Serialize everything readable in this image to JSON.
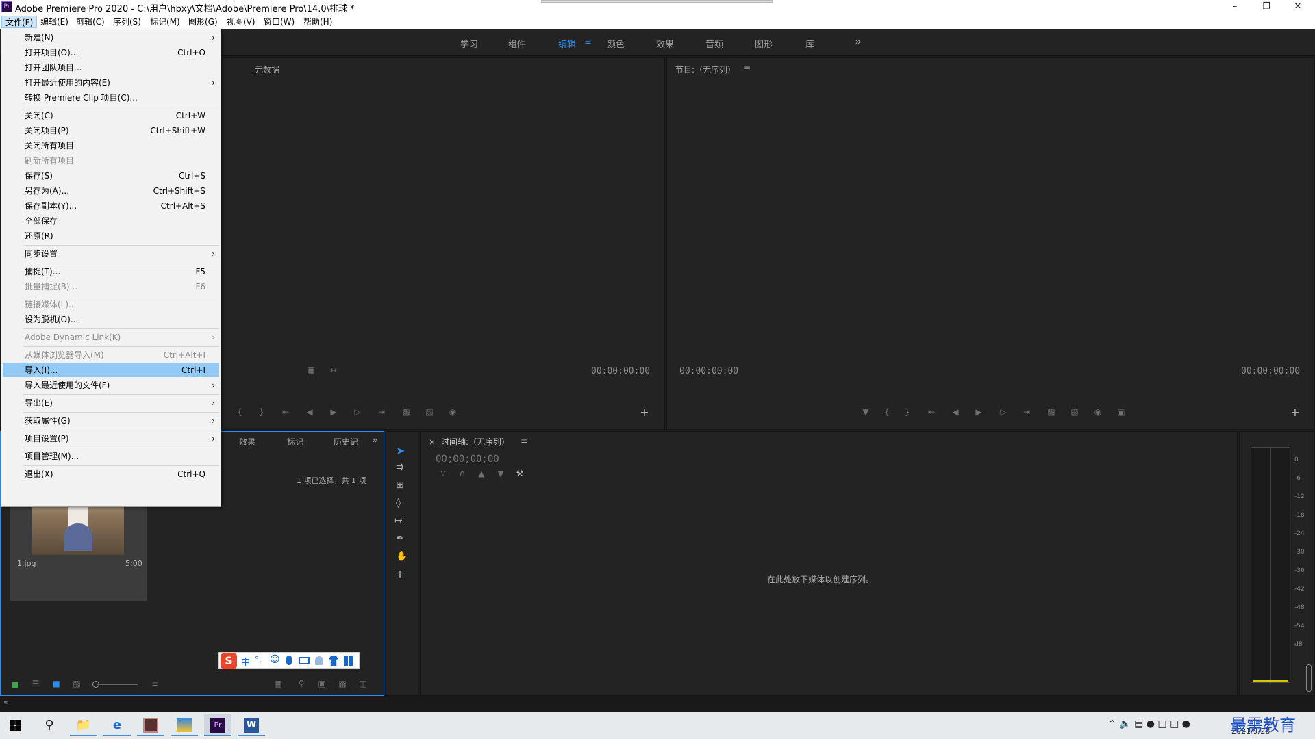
{
  "window": {
    "title": "Adobe Premiere Pro 2020 - C:\\用户\\hbxy\\文档\\Adobe\\Premiere Pro\\14.0\\排球 *",
    "app_icon": "Pr"
  },
  "menubar": [
    "文件(F)",
    "编辑(E)",
    "剪辑(C)",
    "序列(S)",
    "标记(M)",
    "图形(G)",
    "视图(V)",
    "窗口(W)",
    "帮助(H)"
  ],
  "workspaces": {
    "tabs": [
      "学习",
      "组件",
      "编辑",
      "颜色",
      "效果",
      "音频",
      "图形",
      "库"
    ],
    "active": "编辑",
    "more": "»"
  },
  "source_panel": {
    "tab": "元数据",
    "timecode": "00:00:00:00"
  },
  "program_panel": {
    "title": "节目:（无序列）",
    "timecode_left": "00:00:00:00",
    "timecode_right": "00:00:00:00"
  },
  "project_panel": {
    "tabs": [
      "效果",
      "标记",
      "历史记"
    ],
    "selection_info": "1 项已选择，共 1 项",
    "clip": {
      "name": "1.jpg",
      "duration": "5:00"
    }
  },
  "timeline": {
    "title": "时间轴:（无序列）",
    "timecode": "00;00;00;00",
    "empty_hint": "在此处放下媒体以创建序列。"
  },
  "audio_meter": {
    "scale": [
      "0",
      "-6",
      "-12",
      "-18",
      "-24",
      "-30",
      "-36",
      "-42",
      "-48",
      "-54",
      "dB"
    ]
  },
  "file_menu": [
    {
      "label": "新建(N)",
      "shortcut": "",
      "submenu": true,
      "disabled": false
    },
    {
      "label": "打开项目(O)...",
      "shortcut": "Ctrl+O",
      "submenu": false,
      "disabled": false
    },
    {
      "label": "打开团队项目...",
      "shortcut": "",
      "submenu": false,
      "disabled": false
    },
    {
      "label": "打开最近使用的内容(E)",
      "shortcut": "",
      "submenu": true,
      "disabled": false
    },
    {
      "label": "转换 Premiere Clip 项目(C)...",
      "shortcut": "",
      "submenu": false,
      "disabled": false
    },
    {
      "sep": true
    },
    {
      "label": "关闭(C)",
      "shortcut": "Ctrl+W",
      "submenu": false,
      "disabled": false
    },
    {
      "label": "关闭项目(P)",
      "shortcut": "Ctrl+Shift+W",
      "submenu": false,
      "disabled": false
    },
    {
      "label": "关闭所有项目",
      "shortcut": "",
      "submenu": false,
      "disabled": false
    },
    {
      "label": "刷新所有项目",
      "shortcut": "",
      "submenu": false,
      "disabled": true
    },
    {
      "label": "保存(S)",
      "shortcut": "Ctrl+S",
      "submenu": false,
      "disabled": false
    },
    {
      "label": "另存为(A)...",
      "shortcut": "Ctrl+Shift+S",
      "submenu": false,
      "disabled": false
    },
    {
      "label": "保存副本(Y)...",
      "shortcut": "Ctrl+Alt+S",
      "submenu": false,
      "disabled": false
    },
    {
      "label": "全部保存",
      "shortcut": "",
      "submenu": false,
      "disabled": false
    },
    {
      "label": "还原(R)",
      "shortcut": "",
      "submenu": false,
      "disabled": false
    },
    {
      "sep": true
    },
    {
      "label": "同步设置",
      "shortcut": "",
      "submenu": true,
      "disabled": false
    },
    {
      "sep": true
    },
    {
      "label": "捕捉(T)...",
      "shortcut": "F5",
      "submenu": false,
      "disabled": false
    },
    {
      "label": "批量捕捉(B)...",
      "shortcut": "F6",
      "submenu": false,
      "disabled": true
    },
    {
      "sep": true
    },
    {
      "label": "链接媒体(L)...",
      "shortcut": "",
      "submenu": false,
      "disabled": true
    },
    {
      "label": "设为脱机(O)...",
      "shortcut": "",
      "submenu": false,
      "disabled": false
    },
    {
      "sep": true
    },
    {
      "label": "Adobe Dynamic Link(K)",
      "shortcut": "",
      "submenu": true,
      "disabled": true
    },
    {
      "sep": true
    },
    {
      "label": "从媒体浏览器导入(M)",
      "shortcut": "Ctrl+Alt+I",
      "submenu": false,
      "disabled": true
    },
    {
      "label": "导入(I)...",
      "shortcut": "Ctrl+I",
      "submenu": false,
      "disabled": false,
      "highlight": true
    },
    {
      "label": "导入最近使用的文件(F)",
      "shortcut": "",
      "submenu": true,
      "disabled": false
    },
    {
      "sep": true
    },
    {
      "label": "导出(E)",
      "shortcut": "",
      "submenu": true,
      "disabled": false
    },
    {
      "sep": true
    },
    {
      "label": "获取属性(G)",
      "shortcut": "",
      "submenu": true,
      "disabled": false
    },
    {
      "sep": true
    },
    {
      "label": "项目设置(P)",
      "shortcut": "",
      "submenu": true,
      "disabled": false
    },
    {
      "sep": true
    },
    {
      "label": "项目管理(M)...",
      "shortcut": "",
      "submenu": false,
      "disabled": false
    },
    {
      "sep": true
    },
    {
      "label": "退出(X)",
      "shortcut": "Ctrl+Q",
      "submenu": false,
      "disabled": false
    }
  ],
  "ime_bar": {
    "items": [
      "S",
      "中",
      "°,",
      "☺",
      "mic",
      "kbd",
      "user",
      "shirt",
      "grid"
    ]
  },
  "taskbar": {
    "date": "2021/9/28",
    "watermark": "最需教育"
  },
  "colors": {
    "accent": "#2d8ceb",
    "panel": "#232323",
    "menu_highlight": "#91c9f7"
  }
}
